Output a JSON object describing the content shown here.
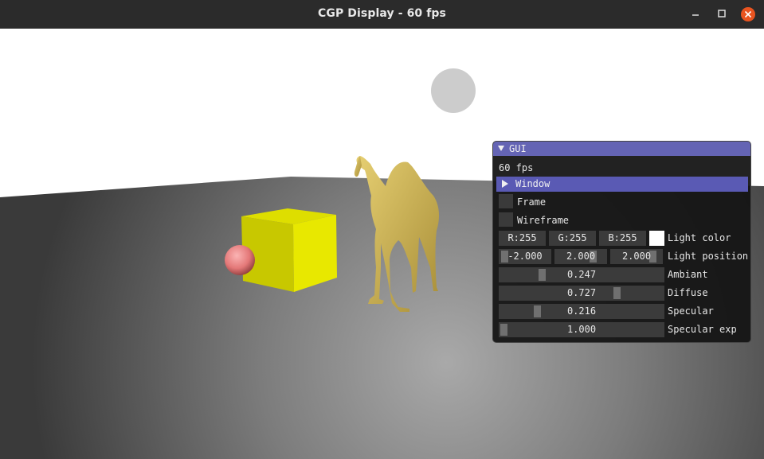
{
  "window": {
    "title": "CGP Display - 60 fps",
    "controls": [
      "minimize-icon",
      "maximize-icon",
      "close-icon"
    ],
    "close_color": "#e95420"
  },
  "scene": {
    "objects": [
      "light-sphere",
      "ground-plane",
      "pink-sphere",
      "yellow-cube",
      "camel-mesh"
    ],
    "sky_color": "#ffffff",
    "cube_color": "#e6e600",
    "sphere_color": "#f08080",
    "camel_color": "#d4bc5c",
    "light_sphere_color": "#cccccc"
  },
  "gui": {
    "header": "GUI",
    "fps_text": "60 fps",
    "tree_node": "Window",
    "frame_label": "Frame",
    "frame_checked": false,
    "wireframe_label": "Wireframe",
    "wireframe_checked": false,
    "color": {
      "r": "R:255",
      "g": "G:255",
      "b": "B:255",
      "swatch": "#ffffff",
      "label": "Light color"
    },
    "position": {
      "x": "-2.000",
      "y": "2.000",
      "z": "2.000",
      "label": "Light position"
    },
    "sliders": [
      {
        "value": "0.247",
        "label": "Ambiant",
        "level": 0.247
      },
      {
        "value": "0.727",
        "label": "Diffuse",
        "level": 0.727
      },
      {
        "value": "0.216",
        "label": "Specular",
        "level": 0.216
      },
      {
        "value": "1.000",
        "label": "Specular exp",
        "level": 0.0
      }
    ]
  }
}
